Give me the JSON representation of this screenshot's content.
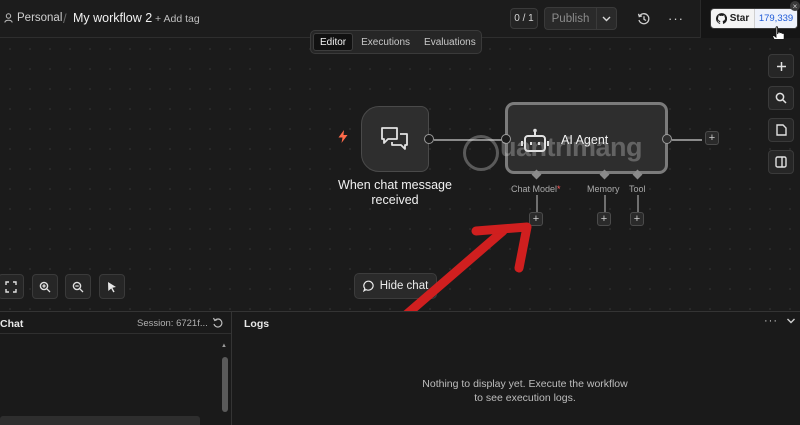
{
  "header": {
    "project": "Personal",
    "separator": "/",
    "workflow_name": "My workflow 2",
    "add_tag": "+ Add tag",
    "version_counter": "0 / 1",
    "publish_label": "Publish",
    "more": "···",
    "github": {
      "star_label": "Star",
      "star_count": "179,339",
      "close": "×"
    }
  },
  "tabs": [
    {
      "label": "Editor",
      "active": true
    },
    {
      "label": "Executions",
      "active": false
    },
    {
      "label": "Evaluations",
      "active": false
    }
  ],
  "canvas": {
    "trigger_node": {
      "label": "When chat message received",
      "icon": "chat-bubbles-icon",
      "badge_icon": "lightning-bolt-icon"
    },
    "agent_node": {
      "label": "AI Agent",
      "icon": "robot-icon"
    },
    "sub_nodes": [
      {
        "label": "Chat Model",
        "required": true,
        "required_mark": "*"
      },
      {
        "label": "Memory",
        "required": false
      },
      {
        "label": "Tool",
        "required": false
      }
    ],
    "watermark": "uantrimang",
    "plus": "+"
  },
  "right_toolbar": [
    "plus-icon",
    "search-icon",
    "sticky-note-icon",
    "panel-toggle-icon"
  ],
  "zoom_toolbar": [
    "fit-view-icon",
    "zoom-in-icon",
    "zoom-out-icon",
    "cursor-select-icon"
  ],
  "hide_chat": {
    "label": "Hide chat",
    "icon": "chat-bubble-icon"
  },
  "chat_panel": {
    "title": "Chat",
    "session": "Session: 6721f..."
  },
  "logs_panel": {
    "title": "Logs",
    "more": "···",
    "empty_message": "Nothing to display yet. Execute the workflow to see execution logs."
  },
  "colors": {
    "background": "#1b1b1b",
    "annotation_arrow": "#d01f1f",
    "trigger_bolt": "#ff6b4a",
    "github_count": "#1f5bd8"
  }
}
